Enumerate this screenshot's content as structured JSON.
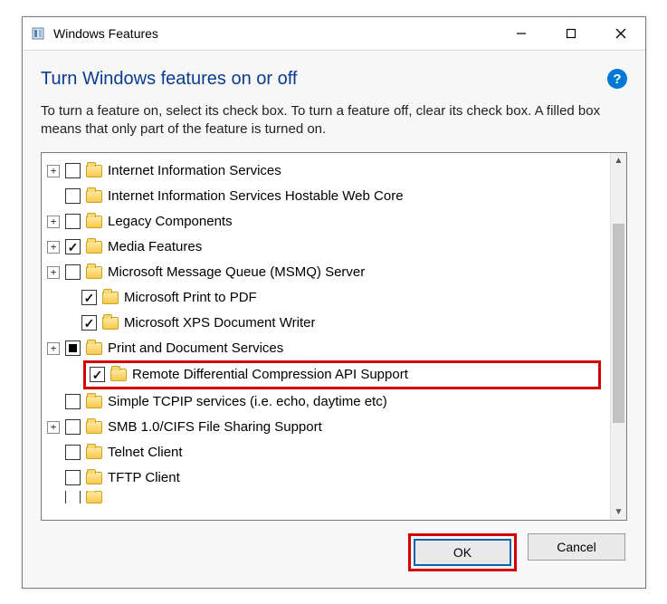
{
  "window": {
    "title": "Windows Features"
  },
  "heading": "Turn Windows features on or off",
  "description": "To turn a feature on, select its check box. To turn a feature off, clear its check box. A filled box means that only part of the feature is turned on.",
  "features": [
    {
      "label": "Internet Information Services",
      "expandable": true,
      "depth": 0,
      "state": "unchecked"
    },
    {
      "label": "Internet Information Services Hostable Web Core",
      "expandable": false,
      "depth": 0,
      "state": "unchecked"
    },
    {
      "label": "Legacy Components",
      "expandable": true,
      "depth": 0,
      "state": "unchecked"
    },
    {
      "label": "Media Features",
      "expandable": true,
      "depth": 0,
      "state": "checked"
    },
    {
      "label": "Microsoft Message Queue (MSMQ) Server",
      "expandable": true,
      "depth": 0,
      "state": "unchecked"
    },
    {
      "label": "Microsoft Print to PDF",
      "expandable": false,
      "depth": 1,
      "state": "checked"
    },
    {
      "label": "Microsoft XPS Document Writer",
      "expandable": false,
      "depth": 1,
      "state": "checked"
    },
    {
      "label": "Print and Document Services",
      "expandable": true,
      "depth": 0,
      "state": "filled"
    },
    {
      "label": "Remote Differential Compression API Support",
      "expandable": false,
      "depth": 0,
      "state": "checked",
      "highlight": true
    },
    {
      "label": "Simple TCPIP services (i.e. echo, daytime etc)",
      "expandable": false,
      "depth": 0,
      "state": "unchecked"
    },
    {
      "label": "SMB 1.0/CIFS File Sharing Support",
      "expandable": true,
      "depth": 0,
      "state": "unchecked"
    },
    {
      "label": "Telnet Client",
      "expandable": false,
      "depth": 0,
      "state": "unchecked"
    },
    {
      "label": "TFTP Client",
      "expandable": false,
      "depth": 0,
      "state": "unchecked"
    },
    {
      "label": "",
      "expandable": false,
      "depth": 0,
      "state": "unchecked",
      "clipped": true
    }
  ],
  "buttons": {
    "ok": "OK",
    "cancel": "Cancel"
  }
}
